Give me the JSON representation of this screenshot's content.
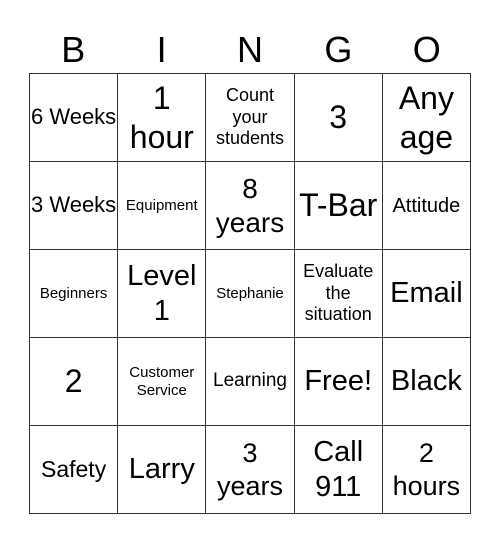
{
  "header": [
    "B",
    "I",
    "N",
    "G",
    "O"
  ],
  "cells": [
    {
      "text": "6 Weeks",
      "size": 22
    },
    {
      "text": "1 hour",
      "size": 32
    },
    {
      "text": "Count your students",
      "size": 18
    },
    {
      "text": "3",
      "size": 32
    },
    {
      "text": "Any age",
      "size": 32
    },
    {
      "text": "3 Weeks",
      "size": 22
    },
    {
      "text": "Equipment",
      "size": 15
    },
    {
      "text": "8 years",
      "size": 28
    },
    {
      "text": "T-Bar",
      "size": 32
    },
    {
      "text": "Attitude",
      "size": 20
    },
    {
      "text": "Beginners",
      "size": 15
    },
    {
      "text": "Level 1",
      "size": 29
    },
    {
      "text": "Stephanie",
      "size": 15
    },
    {
      "text": "Evaluate the situation",
      "size": 18
    },
    {
      "text": "Email",
      "size": 29
    },
    {
      "text": "2",
      "size": 32
    },
    {
      "text": "Customer Service",
      "size": 15
    },
    {
      "text": "Learning",
      "size": 19
    },
    {
      "text": "Free!",
      "size": 29
    },
    {
      "text": "Black",
      "size": 29
    },
    {
      "text": "Safety",
      "size": 23
    },
    {
      "text": "Larry",
      "size": 29
    },
    {
      "text": "3 years",
      "size": 27
    },
    {
      "text": "Call 911",
      "size": 29
    },
    {
      "text": "2 hours",
      "size": 27
    }
  ]
}
